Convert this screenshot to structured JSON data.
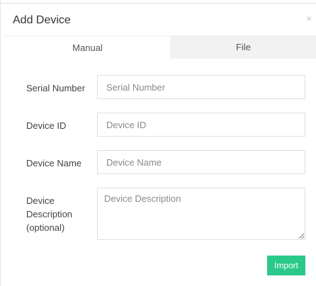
{
  "dialog": {
    "title": "Add Device",
    "close_icon": "close-icon",
    "close_glyph": "×"
  },
  "tabs": [
    {
      "label": "Manual",
      "active": true
    },
    {
      "label": "File",
      "active": false
    }
  ],
  "form": {
    "serial_number": {
      "label": "Serial Number",
      "placeholder": "Serial Number",
      "value": ""
    },
    "device_id": {
      "label": "Device ID",
      "placeholder": "Device ID",
      "value": ""
    },
    "device_name": {
      "label": "Device Name",
      "placeholder": "Device Name",
      "value": ""
    },
    "device_description": {
      "label_line1": "Device",
      "label_line2": "Description",
      "label_line3": "(optional)",
      "placeholder": "Device Description",
      "value": ""
    }
  },
  "actions": {
    "import_label": "Import"
  },
  "colors": {
    "primary": "#2bc989",
    "tab_inactive_bg": "#f2f2f2",
    "border": "#e0e0e0"
  }
}
